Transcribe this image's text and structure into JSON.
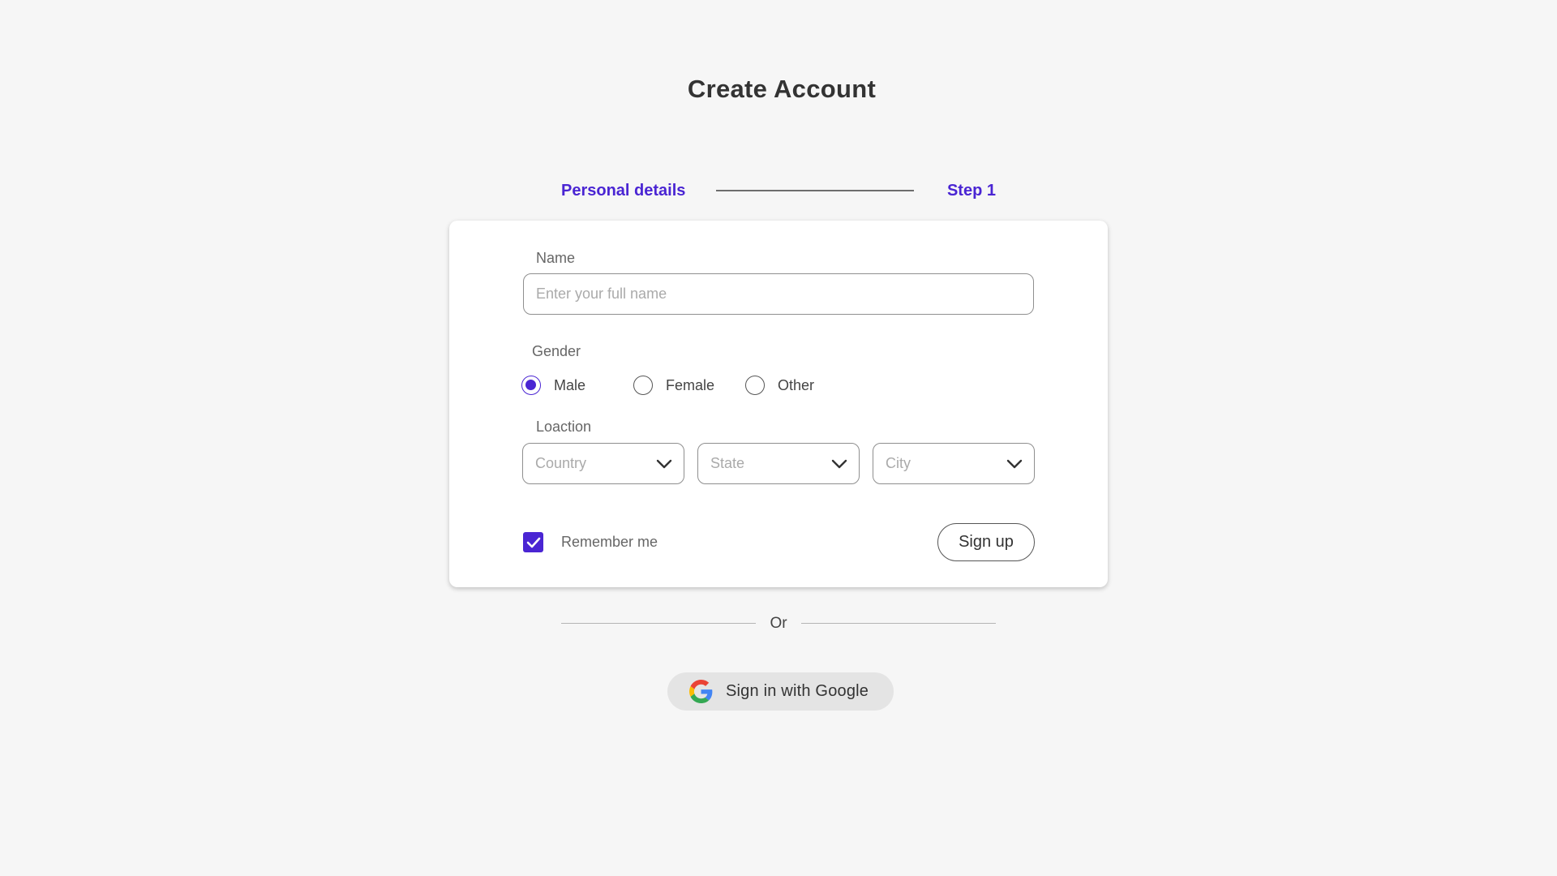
{
  "header": {
    "title": "Create Account"
  },
  "stepper": {
    "label": "Personal details",
    "step": "Step 1",
    "accent": "#4a25d3"
  },
  "form": {
    "name": {
      "label": "Name",
      "placeholder": "Enter your full name",
      "value": ""
    },
    "gender": {
      "label": "Gender",
      "options": [
        "Male",
        "Female",
        "Other"
      ],
      "selected": "Male"
    },
    "location": {
      "label": "Loaction",
      "country_placeholder": "Country",
      "state_placeholder": "State",
      "city_placeholder": "City"
    },
    "remember": {
      "label": "Remember me",
      "checked": true
    },
    "signup_label": "Sign up"
  },
  "divider": {
    "text": "Or"
  },
  "google": {
    "label": "Sign in with Google",
    "icon": "google-icon"
  }
}
